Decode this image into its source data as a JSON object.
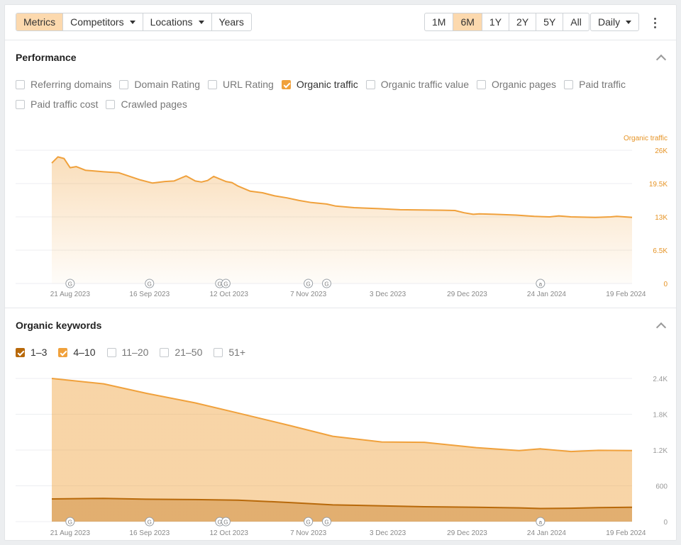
{
  "toolbar": {
    "tabs": [
      {
        "label": "Metrics",
        "active": true
      },
      {
        "label": "Competitors",
        "dropdown": true
      },
      {
        "label": "Locations",
        "dropdown": true
      },
      {
        "label": "Years"
      }
    ],
    "ranges": [
      {
        "label": "1M"
      },
      {
        "label": "6M",
        "active": true
      },
      {
        "label": "1Y"
      },
      {
        "label": "2Y"
      },
      {
        "label": "5Y"
      },
      {
        "label": "All"
      }
    ],
    "interval": {
      "label": "Daily"
    }
  },
  "performance": {
    "title": "Performance",
    "metrics": [
      {
        "label": "Referring domains",
        "checked": false
      },
      {
        "label": "Domain Rating",
        "checked": false
      },
      {
        "label": "URL Rating",
        "checked": false
      },
      {
        "label": "Organic traffic",
        "checked": true
      },
      {
        "label": "Organic traffic value",
        "checked": false
      },
      {
        "label": "Organic pages",
        "checked": false
      },
      {
        "label": "Paid traffic",
        "checked": false
      },
      {
        "label": "Paid traffic cost",
        "checked": false
      },
      {
        "label": "Crawled pages",
        "checked": false
      }
    ]
  },
  "keywords": {
    "title": "Organic keywords",
    "positions": [
      {
        "label": "1–3",
        "checked": true,
        "color": "#b8690a"
      },
      {
        "label": "4–10",
        "checked": true,
        "color": "#f0a13c"
      },
      {
        "label": "11–20",
        "checked": false
      },
      {
        "label": "21–50",
        "checked": false
      },
      {
        "label": "51+",
        "checked": false
      }
    ]
  },
  "colors": {
    "accent": "#f0a13c",
    "accent_dark": "#b8690a",
    "active_bg": "#fcd9ae",
    "axis_label": "#e69426"
  },
  "chart_data": [
    {
      "type": "area",
      "series_label": "Organic traffic",
      "x_ticks": [
        "21 Aug 2023",
        "16 Sep 2023",
        "12 Oct 2023",
        "7 Nov 2023",
        "3 Dec 2023",
        "29 Dec 2023",
        "24 Jan 2024",
        "19 Feb 2024"
      ],
      "y_ticks": [
        "26K",
        "19.5K",
        "13K",
        "6.5K",
        "0"
      ],
      "ylim": [
        0,
        26000
      ],
      "annotations": [
        "G",
        "G",
        "G",
        "G",
        "G",
        "G",
        "a"
      ],
      "series": [
        {
          "name": "Organic traffic",
          "color": "#f0a13c",
          "x": [
            "2023-08-15",
            "2023-08-17",
            "2023-08-19",
            "2023-08-21",
            "2023-08-23",
            "2023-08-26",
            "2023-09-01",
            "2023-09-06",
            "2023-09-10",
            "2023-09-13",
            "2023-09-17",
            "2023-09-21",
            "2023-09-24",
            "2023-09-28",
            "2023-10-01",
            "2023-10-03",
            "2023-10-05",
            "2023-10-07",
            "2023-10-11",
            "2023-10-13",
            "2023-10-15",
            "2023-10-19",
            "2023-10-23",
            "2023-10-27",
            "2023-10-31",
            "2023-11-04",
            "2023-11-08",
            "2023-11-13",
            "2023-11-16",
            "2023-11-22",
            "2023-11-30",
            "2023-12-07",
            "2023-12-14",
            "2023-12-21",
            "2023-12-25",
            "2023-12-28",
            "2023-12-31",
            "2024-01-02",
            "2024-01-07",
            "2024-01-14",
            "2024-01-20",
            "2024-01-25",
            "2024-01-28",
            "2024-02-01",
            "2024-02-09",
            "2024-02-14",
            "2024-02-16",
            "2024-02-21"
          ],
          "values": [
            23500,
            24700,
            24400,
            22600,
            22800,
            22100,
            21800,
            21600,
            20800,
            20200,
            19600,
            19900,
            20000,
            21000,
            20000,
            19800,
            20100,
            20900,
            19900,
            19700,
            19000,
            18000,
            17700,
            17100,
            16700,
            16200,
            15800,
            15500,
            15100,
            14800,
            14600,
            14400,
            14350,
            14300,
            14250,
            13800,
            13500,
            13600,
            13500,
            13350,
            13100,
            13000,
            13200,
            13000,
            12900,
            13000,
            13100,
            12900
          ]
        }
      ]
    },
    {
      "type": "area",
      "x_ticks": [
        "21 Aug 2023",
        "16 Sep 2023",
        "12 Oct 2023",
        "7 Nov 2023",
        "3 Dec 2023",
        "29 Dec 2023",
        "24 Jan 2024",
        "19 Feb 2024"
      ],
      "y_ticks": [
        "2.4K",
        "1.8K",
        "1.2K",
        "600",
        "0"
      ],
      "ylim": [
        0,
        2400
      ],
      "annotations": [
        "G",
        "G",
        "G",
        "G",
        "G",
        "G",
        "a"
      ],
      "stacked": true,
      "series": [
        {
          "name": "1–3",
          "color": "#b8690a",
          "x": [
            "2023-08-15",
            "2023-09-01",
            "2023-09-15",
            "2023-10-01",
            "2023-10-15",
            "2023-11-01",
            "2023-11-15",
            "2023-12-01",
            "2023-12-15",
            "2024-01-01",
            "2024-01-15",
            "2024-01-22",
            "2024-02-01",
            "2024-02-10",
            "2024-02-21"
          ],
          "values": [
            380,
            390,
            375,
            370,
            360,
            320,
            280,
            265,
            250,
            240,
            230,
            220,
            225,
            235,
            240
          ]
        },
        {
          "name": "4–10",
          "color": "#f0a13c",
          "x": [
            "2023-08-15",
            "2023-09-01",
            "2023-09-15",
            "2023-10-01",
            "2023-10-15",
            "2023-11-01",
            "2023-11-15",
            "2023-12-01",
            "2023-12-15",
            "2024-01-01",
            "2024-01-15",
            "2024-01-22",
            "2024-02-01",
            "2024-02-10",
            "2024-02-21"
          ],
          "values": [
            2020,
            1920,
            1775,
            1620,
            1460,
            1290,
            1150,
            1070,
            1080,
            1000,
            960,
            1000,
            950,
            960,
            950
          ]
        }
      ]
    }
  ]
}
